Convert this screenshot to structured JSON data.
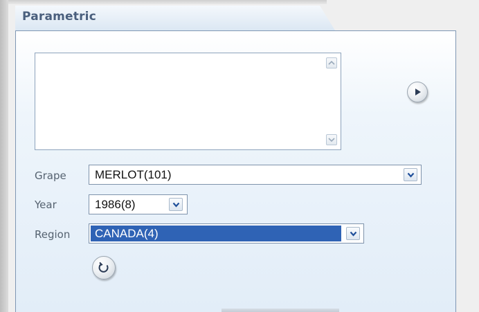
{
  "panel": {
    "title": "Parametric"
  },
  "listbox": {
    "scroll_up_icon": "chevron-up-icon",
    "scroll_down_icon": "chevron-down-icon"
  },
  "go_button": {
    "icon": "play-arrow-icon"
  },
  "fields": {
    "grape": {
      "label": "Grape",
      "value": "MERLOT(101)"
    },
    "year": {
      "label": "Year",
      "value": "1986(8)"
    },
    "region": {
      "label": "Region",
      "value": "CANADA(4)",
      "selected_highlight_color": "#2f63b5"
    }
  },
  "refresh_button": {
    "icon": "refresh-icon"
  },
  "colors": {
    "panel_border": "#7e96b3",
    "title_text": "#4a5f7d",
    "label_text": "#556270",
    "arrow_blue": "#1f4f9a"
  }
}
